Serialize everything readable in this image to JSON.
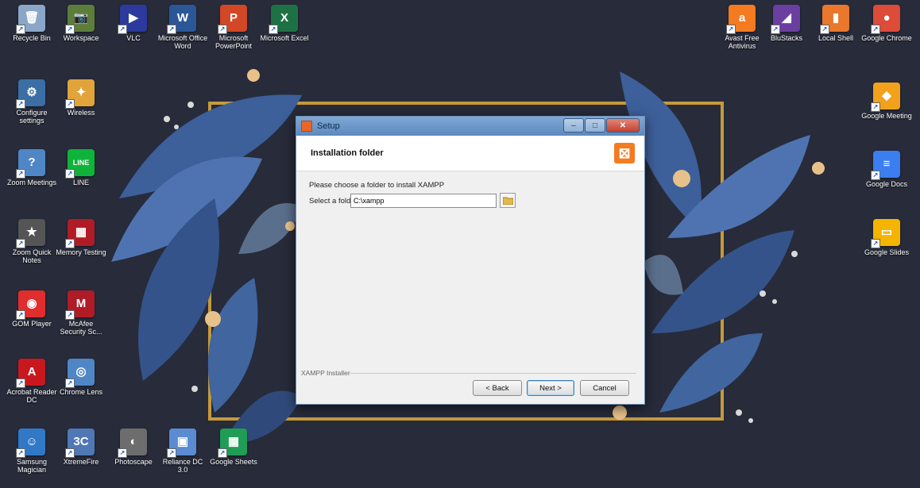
{
  "desktop": {
    "left_icons": [
      {
        "label": "Recycle Bin",
        "glyph": "🗑",
        "color": "#8aa7c8",
        "icon": "recycle-bin-icon"
      },
      {
        "label": "Workspace",
        "glyph": "📷",
        "color": "#5d7e3a",
        "icon": "photo-app-icon"
      },
      {
        "label": "VLC",
        "glyph": "▶",
        "color": "#2b3a9c",
        "icon": "media-disc-icon"
      },
      {
        "label": "Microsoft Office Word",
        "glyph": "W",
        "color": "#2b5797",
        "icon": "word-icon"
      },
      {
        "label": "Microsoft PowerPoint",
        "glyph": "P",
        "color": "#d24726",
        "icon": "powerpoint-icon"
      },
      {
        "label": "Microsoft Excel",
        "glyph": "X",
        "color": "#1e7145",
        "icon": "excel-icon"
      },
      {
        "label": "Configure settings",
        "glyph": "⚙",
        "color": "#3b6ea5",
        "icon": "control-panel-icon"
      },
      {
        "label": "Wireless",
        "glyph": "✦",
        "color": "#e0a43a",
        "icon": "wireless-icon"
      },
      {
        "label": "Zoom Meetings",
        "glyph": "?",
        "color": "#4f86c6",
        "icon": "zoom-icon"
      },
      {
        "label": "LINE",
        "glyph": "LINE",
        "color": "#10b33a",
        "icon": "line-icon"
      },
      {
        "label": "Zoom Quick Notes",
        "glyph": "★",
        "color": "#555555",
        "icon": "notes-icon"
      },
      {
        "label": "Memory Testing",
        "glyph": "▦",
        "color": "#b01c26",
        "icon": "memory-icon"
      },
      {
        "label": "GOM Player",
        "glyph": "◉",
        "color": "#e02d2d",
        "icon": "gom-player-icon"
      },
      {
        "label": "McAfee Security Sc...",
        "glyph": "M",
        "color": "#b01c26",
        "icon": "mcafee-icon"
      },
      {
        "label": "Acrobat Reader DC",
        "glyph": "A",
        "color": "#c8181e",
        "icon": "acrobat-icon"
      },
      {
        "label": "Chrome Lens",
        "glyph": "◎",
        "color": "#4f86c6",
        "icon": "lens-icon"
      },
      {
        "label": "Samsung Magician",
        "glyph": "☺",
        "color": "#3178c6",
        "icon": "smiley-icon"
      },
      {
        "label": "XtremeFire",
        "glyph": "3C",
        "color": "#4f78b5",
        "icon": "xtreme-icon"
      },
      {
        "label": "Photoscape",
        "glyph": "◐",
        "color": "#6d6d6d",
        "icon": "photoscape-icon"
      },
      {
        "label": "Reliance DC 3.0",
        "glyph": "▣",
        "color": "#5b8bd0",
        "icon": "cube-icon"
      },
      {
        "label": "Google Sheets",
        "glyph": "▦",
        "color": "#1f9d55",
        "icon": "google-sheets-icon"
      }
    ],
    "right_icons": [
      {
        "label": "Avast Free Antivirus",
        "glyph": "a",
        "color": "#f47b20",
        "icon": "avast-icon"
      },
      {
        "label": "BluStacks",
        "glyph": "◢",
        "color": "#6a3fa0",
        "icon": "bluestacks-icon"
      },
      {
        "label": "Local Shell",
        "glyph": "▮",
        "color": "#e9782c",
        "icon": "shell-icon"
      },
      {
        "label": "Google Chrome",
        "glyph": "●",
        "color": "#dd4b39",
        "icon": "chrome-icon"
      },
      {
        "label": "Google Meeting",
        "glyph": "◆",
        "color": "#f2a11c",
        "icon": "cube-orange-icon"
      },
      {
        "label": "Google Docs",
        "glyph": "≡",
        "color": "#3b7ef0",
        "icon": "google-docs-icon"
      },
      {
        "label": "Google Slides",
        "glyph": "▭",
        "color": "#f4b400",
        "icon": "google-slides-icon"
      }
    ]
  },
  "dialog": {
    "title": "Setup",
    "header_title": "Installation folder",
    "prompt": "Please choose a folder to install XAMPP",
    "field_label": "Select a folder",
    "folder_value": "C:\\xampp",
    "brand": "XAMPP Installer",
    "back_label": "< Back",
    "next_label": "Next >",
    "cancel_label": "Cancel",
    "logo_glyph": "⊠"
  }
}
